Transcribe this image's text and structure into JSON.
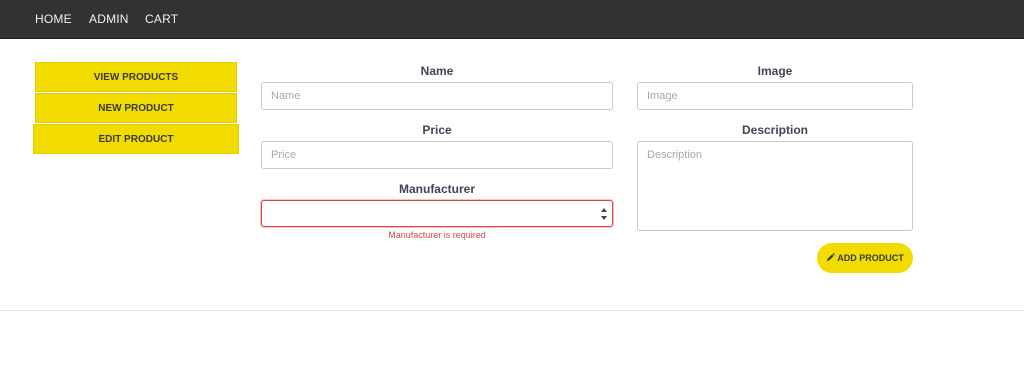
{
  "nav": {
    "items": [
      {
        "label": "HOME"
      },
      {
        "label": "ADMIN"
      },
      {
        "label": "CART"
      }
    ]
  },
  "sidebar": {
    "items": [
      {
        "label": "VIEW PRODUCTS"
      },
      {
        "label": "NEW PRODUCT"
      },
      {
        "label": "EDIT PRODUCT"
      }
    ]
  },
  "form": {
    "name": {
      "label": "Name",
      "placeholder": "Name",
      "value": ""
    },
    "price": {
      "label": "Price",
      "placeholder": "Price",
      "value": ""
    },
    "manufacturer": {
      "label": "Manufacturer",
      "value": "",
      "error": "Manufacturer is required"
    },
    "image": {
      "label": "Image",
      "placeholder": "Image",
      "value": ""
    },
    "description": {
      "label": "Description",
      "placeholder": "Description",
      "value": ""
    },
    "submit_label": "ADD PRODUCT"
  },
  "colors": {
    "nav_bg": "#323232",
    "accent_yellow": "#f2dc00",
    "error_red": "#e0444c"
  },
  "icons": {
    "submit_icon": "pencil-icon",
    "select_icon": "sort-arrows-icon"
  }
}
